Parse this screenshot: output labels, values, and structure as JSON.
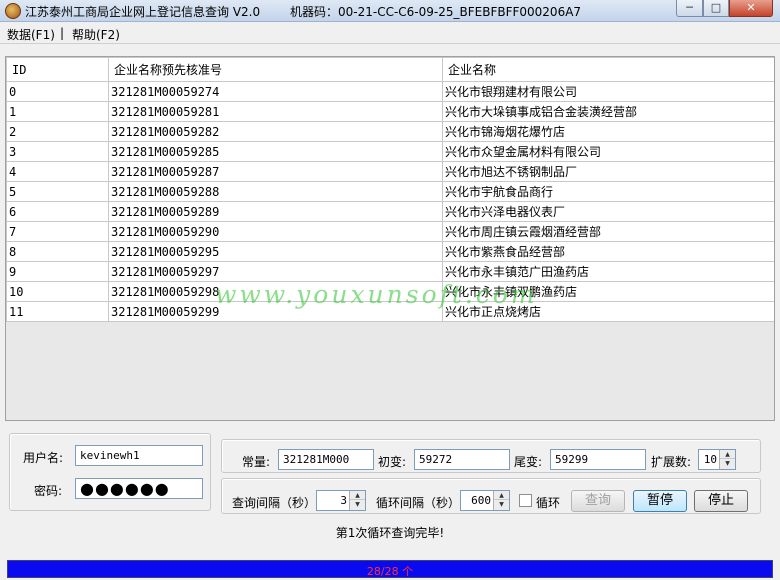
{
  "window": {
    "title": "江苏泰州工商局企业网上登记信息查询 V2.0",
    "machine_code": "机器码：00-21-CC-C6-09-25_BFEBFBFF000206A7",
    "min_glyph": "─",
    "max_glyph": "□",
    "close_glyph": "✕"
  },
  "menu": {
    "data_label": "数据(F1)",
    "separator": "|",
    "help_label": "帮助(F2)"
  },
  "grid": {
    "headers": [
      "ID",
      "企业名称预先核准号",
      "企业名称"
    ],
    "rows": [
      [
        "0",
        "321281M00059274",
        "兴化市银翔建材有限公司"
      ],
      [
        "1",
        "321281M00059281",
        "兴化市大垛镇事成铝合金装潢经营部"
      ],
      [
        "2",
        "321281M00059282",
        "兴化市锦海烟花爆竹店"
      ],
      [
        "3",
        "321281M00059285",
        "兴化市众望金属材料有限公司"
      ],
      [
        "4",
        "321281M00059287",
        "兴化市旭达不锈钢制品厂"
      ],
      [
        "5",
        "321281M00059288",
        "兴化市宇航食品商行"
      ],
      [
        "6",
        "321281M00059289",
        "兴化市兴泽电器仪表厂"
      ],
      [
        "7",
        "321281M00059290",
        "兴化市周庄镇云霞烟酒经营部"
      ],
      [
        "8",
        "321281M00059295",
        "兴化市紫燕食品经营部"
      ],
      [
        "9",
        "321281M00059297",
        "兴化市永丰镇范广田渔药店"
      ],
      [
        "10",
        "321281M00059298",
        "兴化市永丰镇双鹏渔药店"
      ],
      [
        "11",
        "321281M00059299",
        "兴化市正点烧烤店"
      ]
    ]
  },
  "watermark": "www.youxunsoft.com",
  "login": {
    "user_label": "用户名:",
    "user_value": "kevinewh1",
    "password_label": "密码:",
    "password_value": "●●●●●●"
  },
  "params": {
    "const_label": "常量:",
    "const_value": "321281M000",
    "init_label": "初变:",
    "init_value": "59272",
    "tail_label": "尾变:",
    "tail_value": "59299",
    "ext_label": "扩展数:",
    "ext_value": "10"
  },
  "controls": {
    "query_interval_label": "查询间隔（秒）:",
    "query_interval_value": "3",
    "loop_interval_label": "循环间隔（秒）:",
    "loop_interval_value": "600",
    "loop_checkbox_label": "循环",
    "query_button": "查询",
    "pause_button": "暂停",
    "stop_button": "停止",
    "spin_up_glyph": "▲",
    "spin_down_glyph": "▼"
  },
  "status": {
    "message": "第1次循环查询完毕!",
    "progress_text": "28/28 个",
    "progress_fraction": 1.0
  }
}
